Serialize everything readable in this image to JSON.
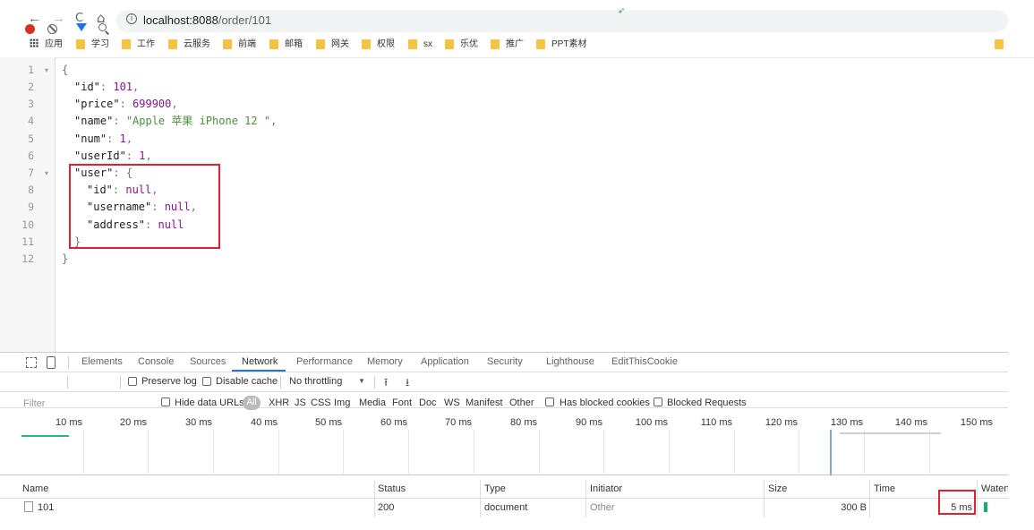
{
  "browser": {
    "nav": {
      "back": "←",
      "forward": "→",
      "reload": "C",
      "home": "⌂"
    },
    "info_glyph": "i",
    "url_host": "localhost:8088",
    "url_path": "/order/101"
  },
  "bookmarks": {
    "apps_label": "应用",
    "items": [
      "学习",
      "工作",
      "云服务",
      "前端",
      "邮箱",
      "网关",
      "权限",
      "sx",
      "乐优",
      "推广",
      "PPT素材"
    ],
    "folder_color": "#f5c242"
  },
  "json_view": {
    "line_numbers": [
      "1",
      "2",
      "3",
      "4",
      "5",
      "6",
      "7",
      "8",
      "9",
      "10",
      "11",
      "12"
    ],
    "fold_marker": "▾",
    "brace_open": "{",
    "brace_close": "}",
    "fields": {
      "id": {
        "key": "\"id\"",
        "value": "101"
      },
      "price": {
        "key": "\"price\"",
        "value": "699900"
      },
      "name": {
        "key": "\"name\"",
        "value": "\"Apple 苹果 iPhone 12 \""
      },
      "num": {
        "key": "\"num\"",
        "value": "1"
      },
      "userId": {
        "key": "\"userId\"",
        "value": "1"
      },
      "user": {
        "key": "\"user\""
      },
      "user_id": {
        "key": "\"id\"",
        "value": "null"
      },
      "user_username": {
        "key": "\"username\"",
        "value": "null"
      },
      "user_address": {
        "key": "\"address\"",
        "value": "null"
      }
    },
    "highlight_color": "#dd2233"
  },
  "devtools": {
    "tabs": [
      "Elements",
      "Console",
      "Sources",
      "Network",
      "Performance",
      "Memory",
      "Application",
      "Security",
      "Lighthouse",
      "EditThisCookie"
    ],
    "active_tab": "Network",
    "controls": {
      "preserve_log": "Preserve log",
      "disable_cache": "Disable cache",
      "throttling": "No throttling",
      "throttling_arrow": "▼",
      "import_icon": "⭱",
      "export_icon": "⭳"
    },
    "filter": {
      "placeholder": "Filter",
      "hide_data_urls": "Hide data URLs",
      "all": "All",
      "types": [
        "XHR",
        "JS",
        "CSS",
        "Img",
        "Media",
        "Font",
        "Doc",
        "WS",
        "Manifest",
        "Other"
      ],
      "has_blocked_cookies": "Has blocked cookies",
      "blocked_requests": "Blocked Requests"
    },
    "timeline_ticks": [
      "10 ms",
      "20 ms",
      "30 ms",
      "40 ms",
      "50 ms",
      "60 ms",
      "70 ms",
      "80 ms",
      "90 ms",
      "100 ms",
      "110 ms",
      "120 ms",
      "130 ms",
      "140 ms",
      "150 ms"
    ],
    "columns": [
      "Name",
      "Status",
      "Type",
      "Initiator",
      "Size",
      "Time",
      "Waterfall"
    ],
    "rows": [
      {
        "name": "101",
        "status": "200",
        "type": "document",
        "initiator": "Other",
        "size": "300 B",
        "time": "5 ms"
      }
    ],
    "accent_color": "#1a73e8",
    "record_color": "#d93025",
    "waterfall_color": "#15b06b"
  }
}
